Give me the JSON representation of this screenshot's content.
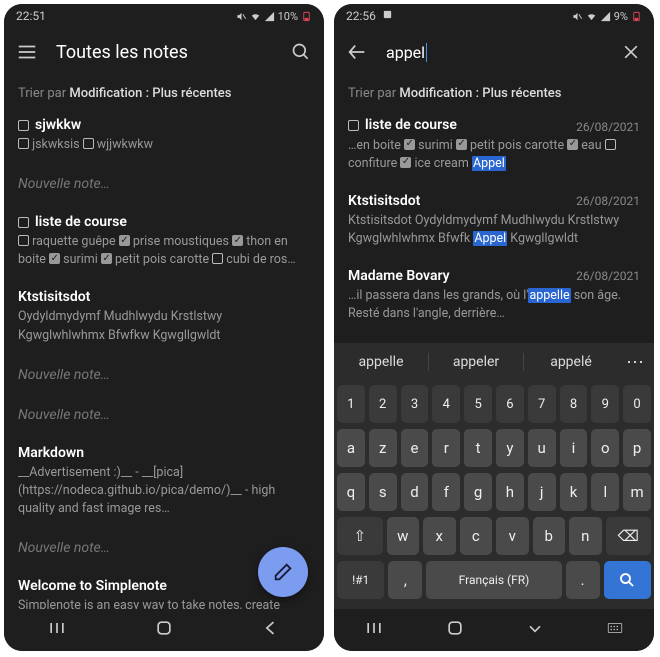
{
  "left": {
    "status": {
      "time": "22:51",
      "battery": "10%"
    },
    "appbar": {
      "title": "Toutes les notes"
    },
    "sort": {
      "label": "Trier par ",
      "value": "Modification : Plus récentes"
    },
    "notes": {
      "n0": {
        "title": "sjwkkw",
        "preview_a": "jskwksis",
        "preview_b": "wjjwkwkw"
      },
      "ph1": "Nouvelle note…",
      "n1": {
        "title": "liste de course",
        "p_a": "raquette guêpe",
        "p_b": "prise moustiques",
        "p_c": "thon en boite",
        "p_d": "surimi",
        "p_e": "petit pois carotte",
        "p_f": "cubi de ros…"
      },
      "n2": {
        "title": "Ktstisitsdot",
        "preview": "Oydyldmydymf Mudhlwydu Krstlstwy Kgwglwhlwhmx Bfwfkw Kgwgllgwldt"
      },
      "ph2": "Nouvelle note…",
      "ph3": "Nouvelle note…",
      "n3": {
        "title": "Markdown",
        "preview": "__Advertisement :)__ - __[pica](https://nodeca.github.io/pica/demo/)__ - high quality and fast image  res…"
      },
      "ph4": "Nouvelle note…",
      "n4": {
        "title": "Welcome to Simplenote",
        "preview": "Simplenote is an easy way to take notes, create"
      }
    }
  },
  "right": {
    "status": {
      "time": "22:56",
      "battery": "9%"
    },
    "search": {
      "query": "appel"
    },
    "sort": {
      "label": "Trier par ",
      "value": "Modification : Plus récentes"
    },
    "results": {
      "r0": {
        "title": "liste de course",
        "date": "26/08/2021",
        "p_a": "…en boite",
        "p_b": "surimi",
        "p_c": "petit pois carotte",
        "p_d": "eau",
        "p_e": "confiture",
        "p_f": "ice cream",
        "p_hl": "Appel"
      },
      "r1": {
        "title": "Ktstisitsdot",
        "date": "26/08/2021",
        "p_a": "Ktstisitsdot   Oydyldmydymf Mudhlwydu Krstlstwy Kgwglwhlwhmx Bfwfk ",
        "p_hl": "Appel",
        "p_b": " Kgwgllgwldt"
      },
      "r2": {
        "title": "Madame Bovary",
        "date": "26/08/2021",
        "p_a": "…il passera dans les grands, où l'",
        "p_hl": "appelle",
        "p_b": " son âge. Resté dans l'angle, derrière…"
      }
    },
    "suggestions": {
      "s0": "appelle",
      "s1": "appeler",
      "s2": "appelé"
    },
    "keyboard": {
      "nums": [
        "1",
        "2",
        "3",
        "4",
        "5",
        "6",
        "7",
        "8",
        "9",
        "0"
      ],
      "row1": [
        "a",
        "z",
        "e",
        "r",
        "t",
        "y",
        "u",
        "i",
        "o",
        "p"
      ],
      "row2": [
        "q",
        "s",
        "d",
        "f",
        "g",
        "h",
        "j",
        "k",
        "l",
        "m"
      ],
      "row3": [
        "w",
        "x",
        "c",
        "v",
        "b",
        "n"
      ],
      "shift": "⇧",
      "bksp": "⌫",
      "sym": "!#1",
      "comma": ",",
      "space": "Français (FR)",
      "dot": "."
    }
  }
}
